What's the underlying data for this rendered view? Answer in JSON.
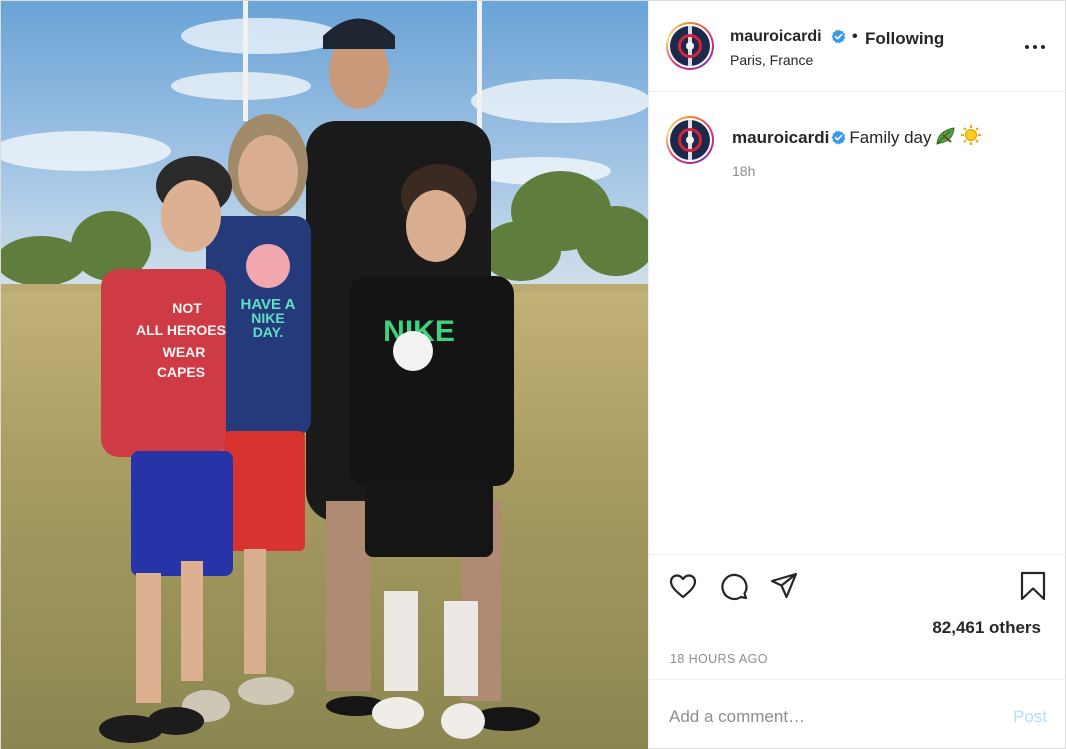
{
  "post": {
    "username": "mauroicardi",
    "follow_separator": "•",
    "follow_status": "Following",
    "location": "Paris, France",
    "caption": {
      "username": "mauroicardi",
      "text": "Family day",
      "emojis": [
        "leaf-emoji",
        "sun-emoji"
      ]
    },
    "time_ago": "18h",
    "likes_text": "82,461 others",
    "date_label": "18 HOURS AGO",
    "comment_placeholder": "Add a comment…",
    "post_button_label": "Post"
  },
  "photo": {
    "shirt_texts": {
      "red_shirt": [
        "NOT",
        "ALL HEROES",
        "WEAR",
        "CAPES"
      ],
      "blue_shirt": [
        "HAVE A",
        "NIKE",
        "DAY."
      ],
      "black_shirt": "NIKE"
    }
  },
  "colors": {
    "verified_blue": "#3897f0",
    "post_button_disabled": "#b2dffc",
    "muted_text": "#8e8e8e",
    "border": "#efefef"
  }
}
